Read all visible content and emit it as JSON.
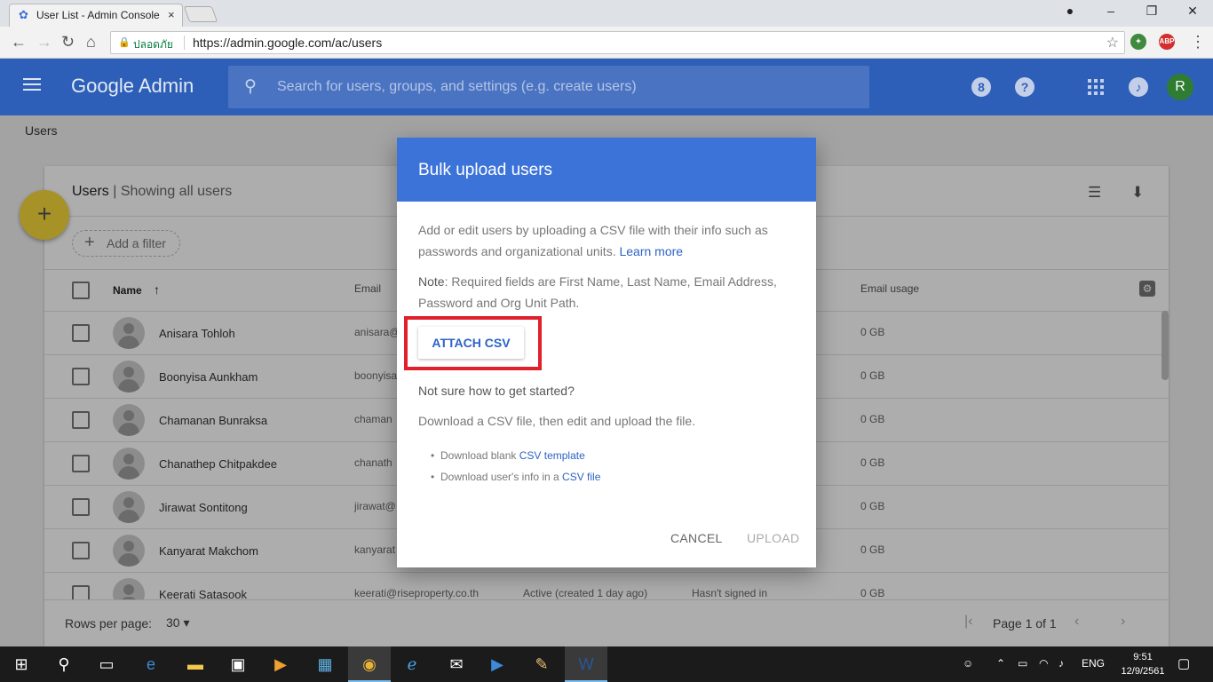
{
  "browser": {
    "tab_title": "User List - Admin Console",
    "tab_close": "×",
    "secure_label": "ปลอดภัย",
    "url": "https://admin.google.com/ac/users",
    "star": "☆",
    "ext_abp": "ABP"
  },
  "header": {
    "brand": "Google Admin",
    "search_placeholder": "Search for users, groups, and settings (e.g. create users)",
    "badge_icon": "8",
    "help_icon": "?",
    "avatar_letter": "R"
  },
  "breadcrumb": "Users",
  "card": {
    "title": "Users",
    "subtitle": "Showing all users",
    "add_filter": "Add a filter",
    "fab": "+",
    "columns": {
      "name": "Name",
      "sort_arrow": "↑",
      "email": "Email",
      "email_usage": "Email usage"
    },
    "rows": [
      {
        "name": "Anisara Tohloh",
        "email": "anisara@",
        "status": "",
        "last_signin": "",
        "usage": "0 GB"
      },
      {
        "name": "Boonyisa Aunkham",
        "email": "boonyisa",
        "status": "",
        "last_signin": "",
        "usage": "0 GB"
      },
      {
        "name": "Chamanan Bunraksa",
        "email": "chaman",
        "status": "",
        "last_signin": "",
        "usage": "0 GB"
      },
      {
        "name": "Chanathep Chitpakdee",
        "email": "chanath",
        "status": "",
        "last_signin": "",
        "usage": "0 GB"
      },
      {
        "name": "Jirawat Sontitong",
        "email": "jirawat@",
        "status": "",
        "last_signin": "",
        "usage": "0 GB"
      },
      {
        "name": "Kanyarat Makchom",
        "email": "kanyarat",
        "status": "",
        "last_signin": "",
        "usage": "0 GB"
      },
      {
        "name": "Keerati Satasook",
        "email": "keerati@riseproperty.co.th",
        "status": "Active (created 1 day ago)",
        "last_signin": "Hasn't signed in",
        "usage": "0 GB"
      }
    ],
    "footer": {
      "rows_per_page_label": "Rows per page:",
      "rows_per_page_value": "30 ▾",
      "page_info": "Page 1 of 1",
      "first": "|‹",
      "prev": "‹",
      "next": "›"
    }
  },
  "dialog": {
    "title": "Bulk upload users",
    "description": "Add or edit users by uploading a CSV file with their info such as passwords and organizational units.",
    "learn_more": "Learn more",
    "note_label": "Note",
    "note_text": ": Required fields are First Name, Last Name, Email Address, Password and Org Unit Path.",
    "attach_button": "ATTACH CSV",
    "question": "Not sure how to get started?",
    "instruction": "Download a CSV file, then edit and upload the file.",
    "links": [
      {
        "prefix": "Download blank ",
        "link": "CSV template"
      },
      {
        "prefix": "Download user's info in a ",
        "link": "CSV file"
      }
    ],
    "cancel": "CANCEL",
    "upload": "UPLOAD"
  },
  "taskbar": {
    "language": "ENG",
    "time": "9:51",
    "date": "12/9/2561"
  },
  "colors": {
    "appbar": "#2d5fb8",
    "dialog_header": "#3b73d9",
    "link": "#2c63c7",
    "highlight": "#e0202b",
    "fab": "#f7d73c"
  }
}
